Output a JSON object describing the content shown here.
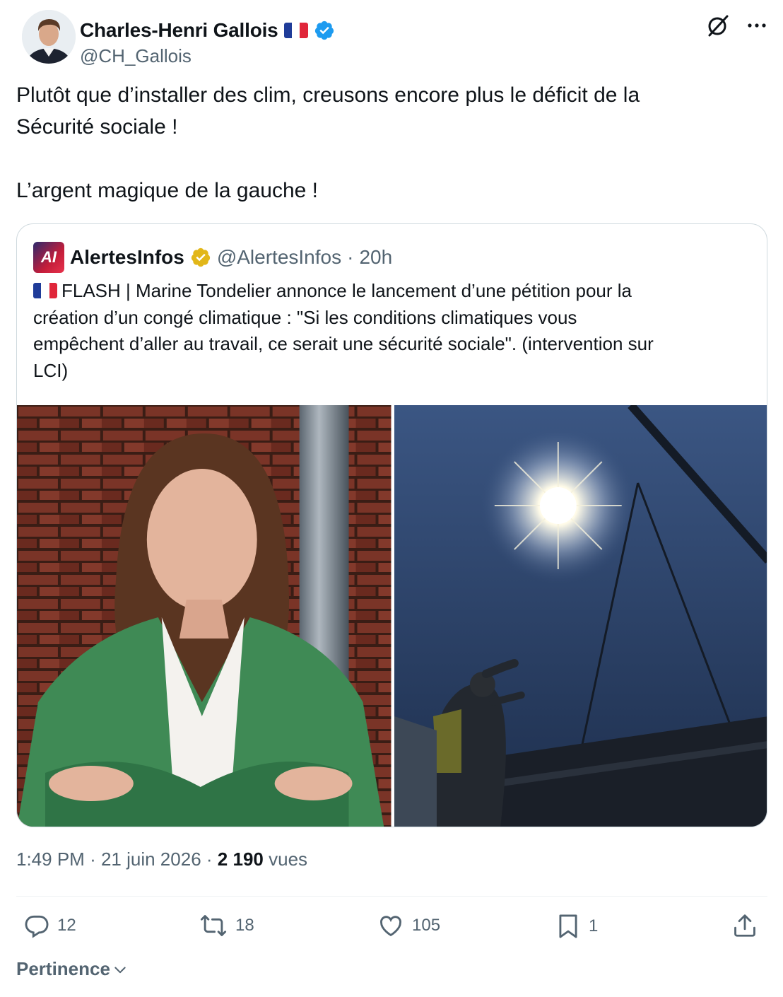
{
  "author": {
    "name": "Charles-Henri Gallois",
    "handle": "@CH_Gallois"
  },
  "tweet": {
    "lines": [
      "Plutôt que d’installer des clim, creusons encore plus le déficit de la",
      "Sécurité sociale !",
      "L’argent magique de la gauche !"
    ]
  },
  "quote": {
    "name": "AlertesInfos",
    "handle": "@AlertesInfos",
    "separator": "·",
    "time": "20h",
    "logo_text": "AI",
    "lines": [
      "FLASH | Marine Tondelier annonce le lancement d’une pétition pour la",
      "création d’un congé climatique : \"Si les conditions climatiques vous",
      "empêchent d’aller au travail, ce serait une sécurité sociale\". (intervention sur",
      "LCI)"
    ]
  },
  "meta": {
    "time": "1:49 PM",
    "dot1": "·",
    "date": "21 juin 2026",
    "dot2": "·",
    "views_count": "2 190",
    "views_label": "vues"
  },
  "actions": {
    "replies": "12",
    "reposts": "18",
    "likes": "105",
    "bookmarks": "1"
  },
  "sort": {
    "label": "Pertinence"
  },
  "colors": {
    "text": "#0f1419",
    "secondary": "#536471",
    "verified_blue": "#1d9bf0",
    "verified_gold": "#e2b719",
    "border": "#cfd9de"
  },
  "icons": [
    "verified-badge-icon",
    "grok-icon",
    "more-icon",
    "reply-icon",
    "repost-icon",
    "like-icon",
    "bookmark-icon",
    "share-icon",
    "chevron-down-icon"
  ]
}
